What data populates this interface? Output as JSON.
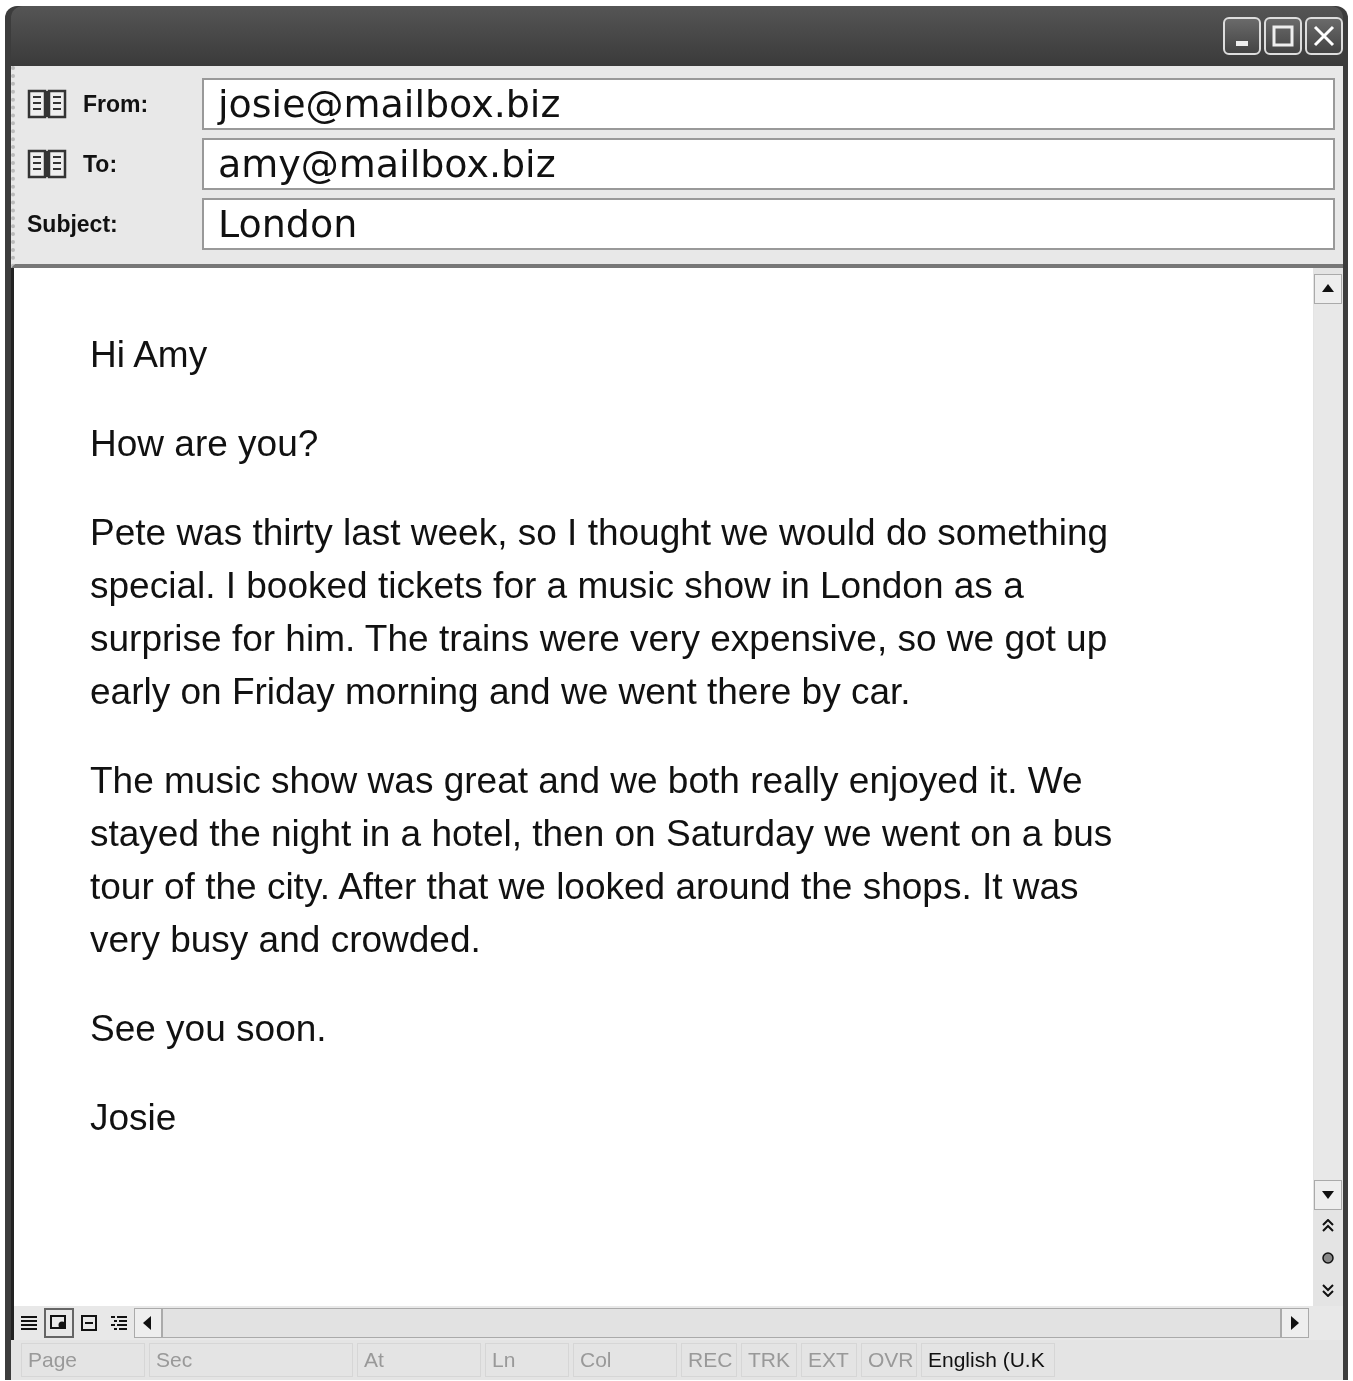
{
  "window": {
    "title_buttons": [
      {
        "kind": "minimize"
      },
      {
        "kind": "maximize"
      },
      {
        "kind": "close"
      }
    ]
  },
  "header": {
    "fields": [
      {
        "label": "From:",
        "value": "josie@mailbox.biz",
        "kind": "address"
      },
      {
        "label": "To:",
        "value": "amy@mailbox.biz",
        "kind": "address"
      },
      {
        "label": "Subject:",
        "value": "London",
        "kind": "plain"
      }
    ]
  },
  "body": {
    "paragraphs": [
      {
        "lines": [
          "Hi Amy"
        ]
      },
      {
        "lines": [
          "How are you?"
        ]
      },
      {
        "lines": [
          "Pete was thirty last week, so I thought we would do something",
          "special. I booked tickets for a music show in London as a",
          "surprise for him. The trains were very expensive, so we got up",
          "early on Friday morning and we went there by car."
        ]
      },
      {
        "lines": [
          "The music show was great and we both really enjoyed it. We",
          "stayed the night in a hotel, then on Saturday we went on a bus",
          "tour of the city. After that we looked around the shops. It was",
          "very busy and crowded."
        ]
      },
      {
        "lines": [
          "See you soon."
        ]
      },
      {
        "lines": [
          "Josie"
        ]
      }
    ]
  },
  "view_buttons": [
    {
      "kind": "normal",
      "selected": false
    },
    {
      "kind": "web",
      "selected": true
    },
    {
      "kind": "print",
      "selected": false
    },
    {
      "kind": "outline",
      "selected": false
    }
  ],
  "status_bar": [
    {
      "text": "Page",
      "disabled": true
    },
    {
      "text": "Sec",
      "disabled": true
    },
    {
      "text": "At",
      "disabled": true
    },
    {
      "text": "Ln",
      "disabled": true
    },
    {
      "text": "Col",
      "disabled": true
    },
    {
      "text": "REC",
      "disabled": true
    },
    {
      "text": "TRK",
      "disabled": true
    },
    {
      "text": "EXT",
      "disabled": true
    },
    {
      "text": "OVR",
      "disabled": true
    },
    {
      "text": "English (U.K",
      "disabled": false
    }
  ]
}
